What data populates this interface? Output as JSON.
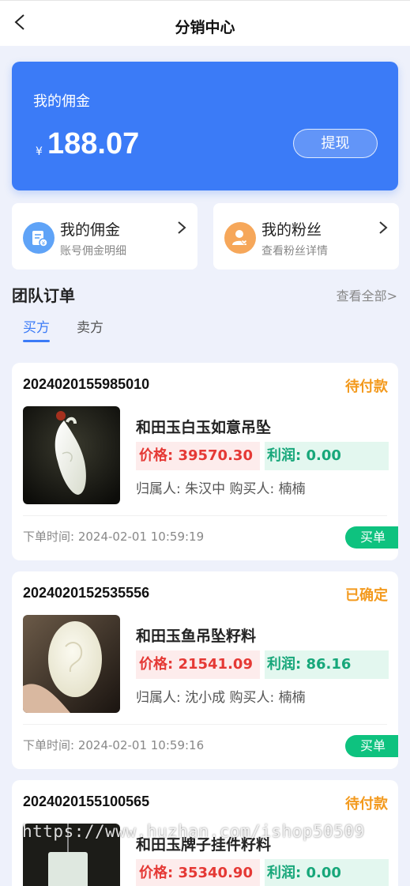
{
  "nav": {
    "title": "分销中心"
  },
  "wallet": {
    "label": "我的佣金",
    "currency": "¥",
    "amount": "188.07",
    "withdraw_label": "提现"
  },
  "entries": [
    {
      "title": "我的佣金",
      "subtitle": "账号佣金明细",
      "icon": "commission-icon",
      "color": "#5fa3f7"
    },
    {
      "title": "我的粉丝",
      "subtitle": "查看粉丝详情",
      "icon": "fans-icon",
      "color": "#f6a75a"
    }
  ],
  "team": {
    "title": "团队订单",
    "see_all": "查看全部>",
    "tabs": [
      {
        "label": "买方"
      },
      {
        "label": "卖方"
      }
    ]
  },
  "orders": [
    {
      "order_no": "2024020155985010",
      "status": "待付款",
      "name": "和田玉白玉如意吊坠",
      "price": "价格:  39570.30",
      "profit": "利润:  0.00",
      "owner": "归属人: 朱汉中   购买人: 楠楠",
      "time": "下单时间: 2024-02-01 10:59:19",
      "tag": "买单"
    },
    {
      "order_no": "2024020152535556",
      "status": "已确定",
      "name": "和田玉鱼吊坠籽料",
      "price": "价格:  21541.09",
      "profit": "利润:  86.16",
      "owner": "归属人: 沈小成   购买人: 楠楠",
      "time": "下单时间: 2024-02-01 10:59:16",
      "tag": "买单"
    },
    {
      "order_no": "2024020155100565",
      "status": "待付款",
      "name": "和田玉牌子挂件籽料",
      "price": "价格:  35340.90",
      "profit": "利润:  0.00",
      "owner": "",
      "time": "",
      "tag": ""
    }
  ],
  "watermark": "https://www.huzhan.com/ishop50509",
  "colors": {
    "primary": "#3b7bf7",
    "warning": "#f39a1e",
    "price": "#e53935",
    "profit": "#17a77a",
    "tag": "#0ec27f"
  }
}
